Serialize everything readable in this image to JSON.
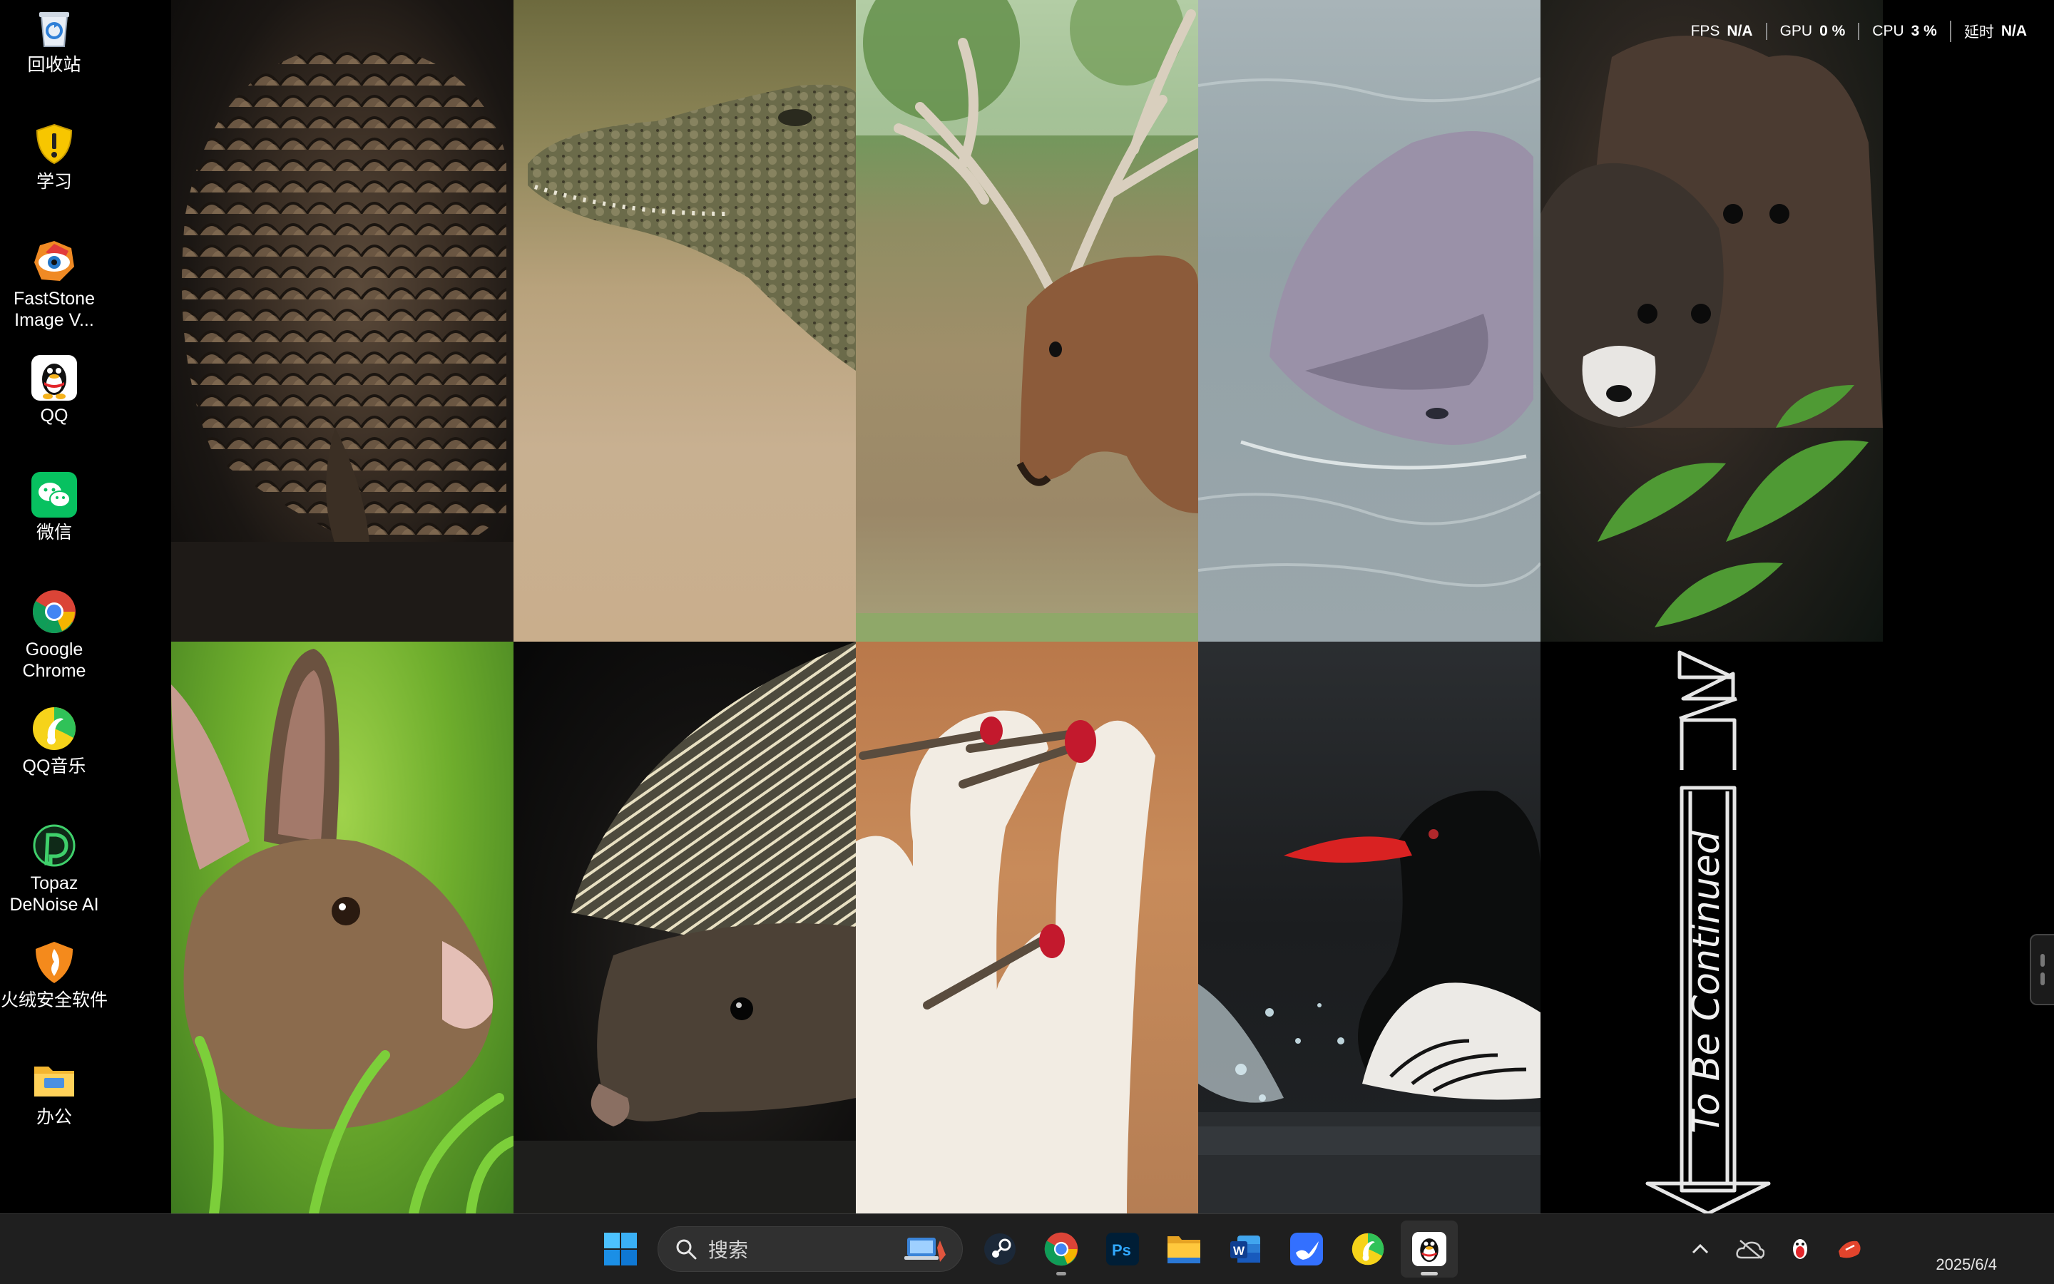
{
  "desktop": {
    "icons": [
      {
        "label": "回收站",
        "icon": "recycle-bin-icon"
      },
      {
        "label": "学习",
        "icon": "warning-shield-icon"
      },
      {
        "label": "FastStone Image V...",
        "icon": "faststone-eye-icon"
      },
      {
        "label": "QQ",
        "icon": "qq-penguin-icon"
      },
      {
        "label": "微信",
        "icon": "wechat-icon"
      },
      {
        "label": "Google Chrome",
        "icon": "chrome-icon"
      },
      {
        "label": "QQ音乐",
        "icon": "qq-music-icon"
      },
      {
        "label": "Topaz DeNoise AI",
        "icon": "topaz-icon"
      },
      {
        "label": "火绒安全软件",
        "icon": "huorong-shield-icon"
      },
      {
        "label": "办公",
        "icon": "folder-icon"
      }
    ]
  },
  "wallpaper": {
    "tiles": [
      "pangolin",
      "caiman",
      "pere-davids-deer",
      "river-dolphin",
      "civet",
      "hare",
      "hedgehog",
      "red-crowned-cranes",
      "scaly-sided-merganser",
      "to-be-continued"
    ],
    "caption": "To Be Continued"
  },
  "overlay": {
    "stats": [
      {
        "key": "FPS",
        "value": "N/A"
      },
      {
        "key": "GPU",
        "value": "0 %"
      },
      {
        "key": "CPU",
        "value": "3 %"
      },
      {
        "key": "延时",
        "value": "N/A"
      }
    ]
  },
  "taskbar": {
    "search_placeholder": "搜索",
    "apps": [
      "start-icon",
      "steam-icon",
      "chrome-icon",
      "photoshop-icon",
      "file-explorer-icon",
      "word-icon",
      "feishu-icon",
      "qq-music-icon",
      "qq-icon"
    ],
    "tray": [
      "chevron-up-icon",
      "cloud-offline-icon",
      "qq-tray-icon",
      "app-tray-icon"
    ],
    "clock_date": "2025/6/4",
    "colors": {
      "bg": "#1f1f1f",
      "accent": "#0a7bd8"
    }
  }
}
